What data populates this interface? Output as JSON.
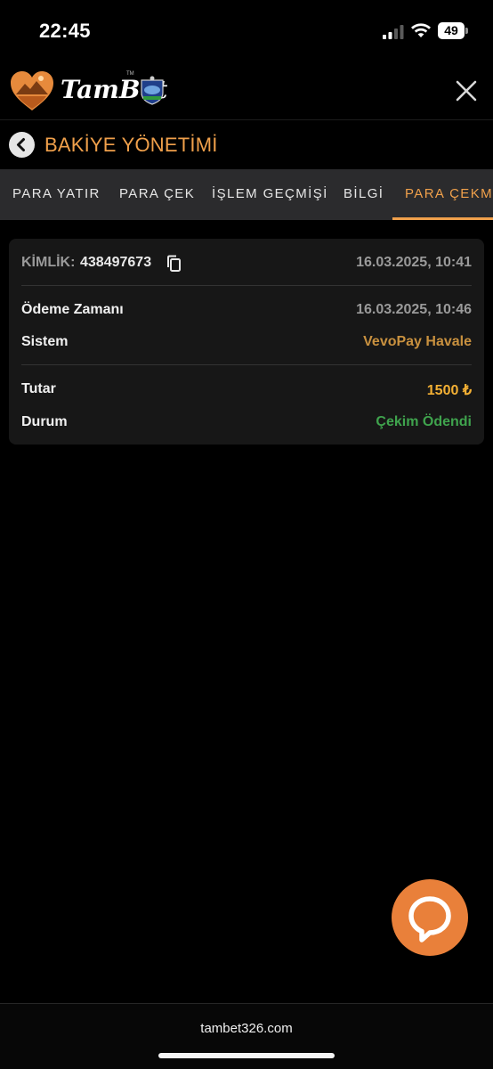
{
  "status_bar": {
    "time": "22:45",
    "battery": "49"
  },
  "header": {
    "brand": "TamBet",
    "tm": "TM",
    "logo_icon": "heart-landscape-icon",
    "partner_icon": "partner-badge-icon",
    "close_icon": "close-icon"
  },
  "page": {
    "title": "BAKİYE YÖNETİMİ",
    "back_icon": "chevron-left-icon"
  },
  "tabs": [
    {
      "label": "PARA YATIR"
    },
    {
      "label": "PARA ÇEK"
    },
    {
      "label": "İŞLEM GEÇMİŞİ"
    },
    {
      "label": "BİLGİ"
    },
    {
      "label": "PARA ÇEKME"
    }
  ],
  "transaction": {
    "id_label": "KİMLİK:",
    "id_value": "438497673",
    "created_at": "16.03.2025, 10:41",
    "rows": [
      {
        "label": "Ödeme Zamanı",
        "value": "16.03.2025, 10:46"
      },
      {
        "label": "Sistem",
        "value": "VevoPay Havale"
      },
      {
        "label": "Tutar",
        "value": "1500 ₺"
      },
      {
        "label": "Durum",
        "value": "Çekim Ödendi"
      }
    ]
  },
  "colors": {
    "accent": "#f0a04b",
    "card_bg": "#171717",
    "tab_bg": "#2b2b2d",
    "success": "#3fa34d",
    "amount": "#f3b034",
    "system": "#c9913f",
    "chat": "#e9803a"
  },
  "chat": {
    "icon": "chat-bubble-icon"
  },
  "footer": {
    "url": "tambet326.com"
  }
}
